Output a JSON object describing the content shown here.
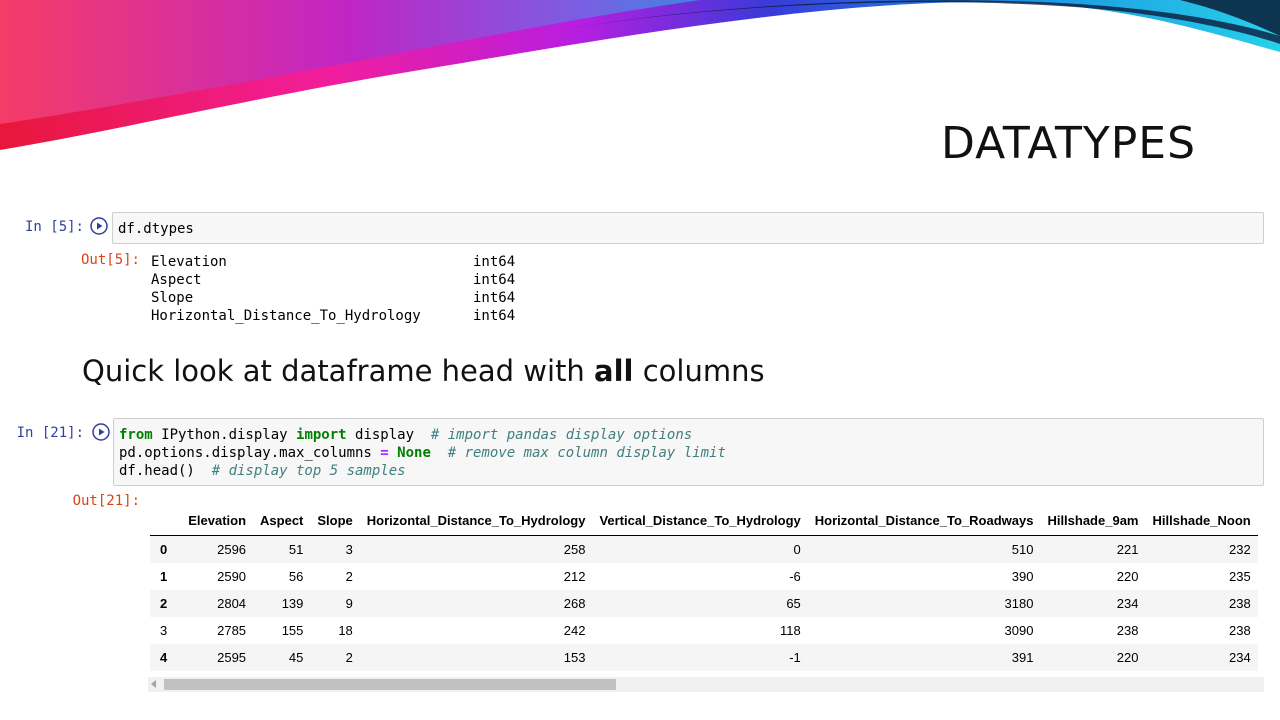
{
  "slide": {
    "title": "DATATYPES"
  },
  "cell1": {
    "in_prompt": "In [5]:",
    "code": "df.dtypes",
    "out_prompt": "Out[5]:",
    "output": [
      {
        "name": "Elevation",
        "dtype": "int64"
      },
      {
        "name": "Aspect",
        "dtype": "int64"
      },
      {
        "name": "Slope",
        "dtype": "int64"
      },
      {
        "name": "Horizontal_Distance_To_Hydrology",
        "dtype": "int64"
      }
    ]
  },
  "subheading": {
    "before": "Quick look at dataframe head with ",
    "bold": "all",
    "after": " columns"
  },
  "cell2": {
    "in_prompt": "In [21]:",
    "code": {
      "line1": {
        "kw1": "from",
        "mod": " IPython.display ",
        "kw2": "import",
        "rest": " display  ",
        "comment": "# import pandas display options"
      },
      "line2": {
        "pre": "pd.options.display.max_columns ",
        "op": "=",
        "sp": " ",
        "kw": "None",
        "gap": "  ",
        "comment": "# remove max column display limit"
      },
      "line3": {
        "pre": "df.head()  ",
        "comment": "# display top 5 samples"
      }
    },
    "out_prompt": "Out[21]:",
    "table": {
      "columns": [
        "Elevation",
        "Aspect",
        "Slope",
        "Horizontal_Distance_To_Hydrology",
        "Vertical_Distance_To_Hydrology",
        "Horizontal_Distance_To_Roadways",
        "Hillshade_9am",
        "Hillshade_Noon"
      ],
      "rows": [
        {
          "index": "0",
          "values": [
            "2596",
            "51",
            "3",
            "258",
            "0",
            "510",
            "221",
            "232"
          ]
        },
        {
          "index": "1",
          "values": [
            "2590",
            "56",
            "2",
            "212",
            "-6",
            "390",
            "220",
            "235"
          ]
        },
        {
          "index": "2",
          "values": [
            "2804",
            "139",
            "9",
            "268",
            "65",
            "3180",
            "234",
            "238"
          ]
        },
        {
          "index": "3",
          "values": [
            "2785",
            "155",
            "18",
            "242",
            "118",
            "3090",
            "238",
            "238"
          ]
        },
        {
          "index": "4",
          "values": [
            "2595",
            "45",
            "2",
            "153",
            "-1",
            "391",
            "220",
            "234"
          ]
        }
      ]
    }
  }
}
